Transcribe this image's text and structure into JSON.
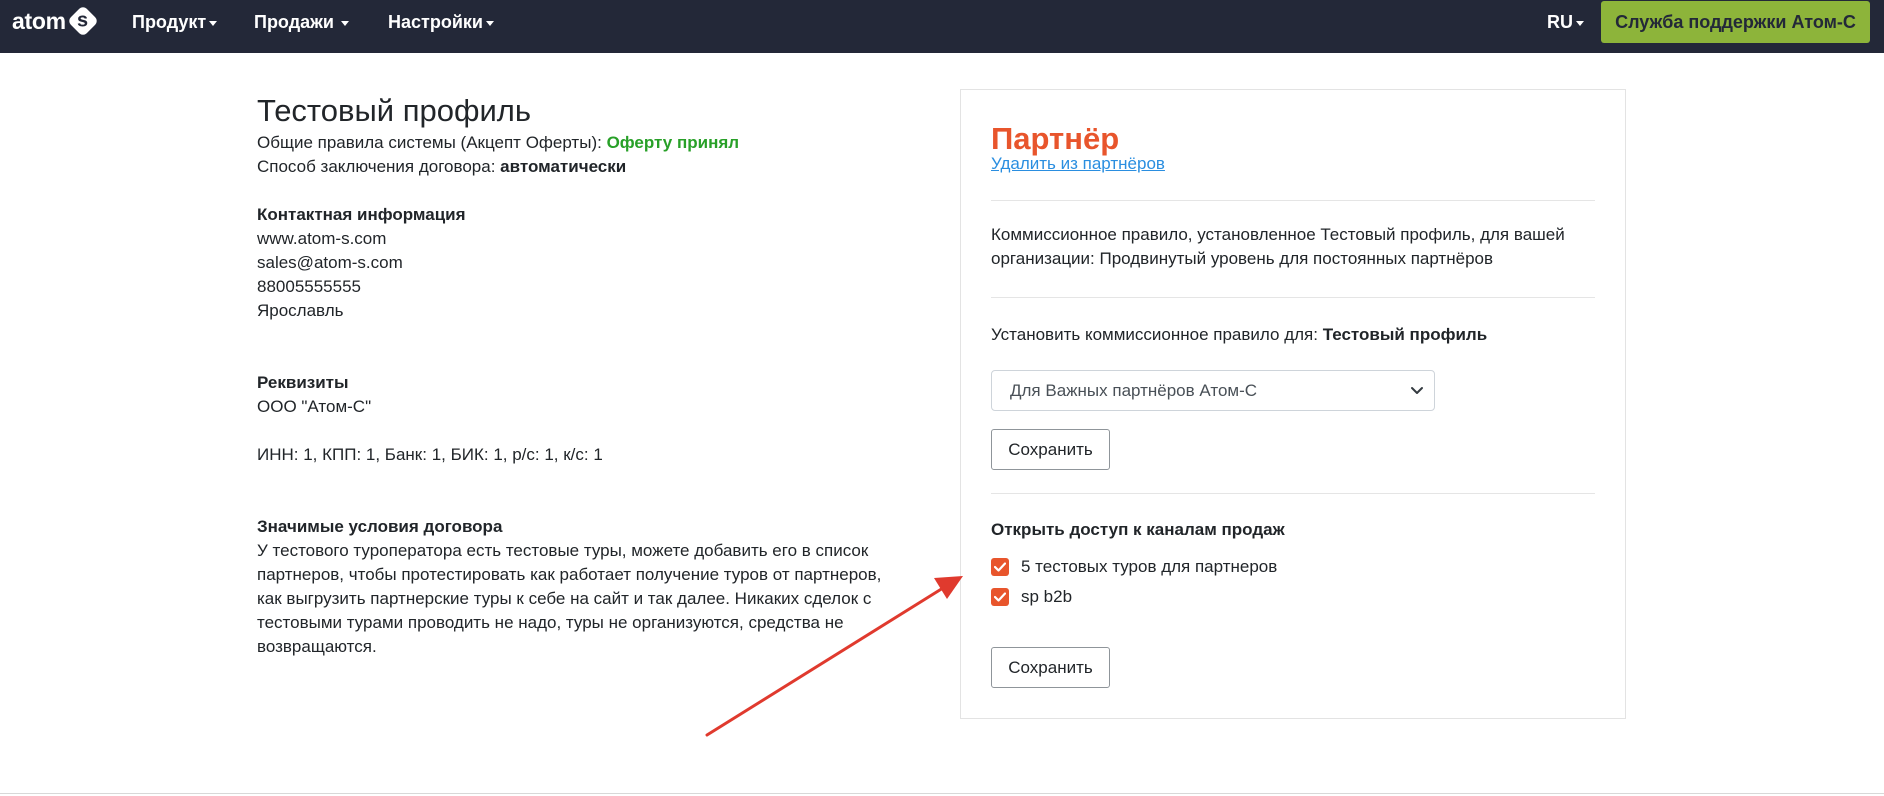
{
  "nav": {
    "logo_text": "atom",
    "logo_badge": "s",
    "items": [
      {
        "label": "Продукт"
      },
      {
        "label": "Продажи"
      },
      {
        "label": "Настройки"
      }
    ],
    "lang": "RU",
    "support_label": "Служба поддержки Атом-С"
  },
  "profile": {
    "title": "Тестовый профиль",
    "rules_label": "Общие правила системы (Акцепт Оферты):",
    "rules_value": "Оферту принял",
    "contract_label": "Способ заключения договора:",
    "contract_value": "автоматически",
    "contacts_title": "Контактная информация",
    "contacts": [
      "www.atom-s.com",
      "sales@atom-s.com",
      "88005555555",
      "Ярославль"
    ],
    "requisites_title": "Реквизиты",
    "company": "ООО \"Атом-С\"",
    "requisites": "ИНН: 1, КПП: 1, Банк: 1, БИК: 1, р/с: 1, к/с: 1",
    "terms_title": "Значимые условия договора",
    "terms_lines": [
      "У тестового туроператора есть тестовые туры, можете добавить его в список",
      "партнеров, чтобы протестировать как работает получение туров от партнеров,",
      "как выгрузить партнерские туры к себе на сайт и так далее. Никаких сделок с",
      "тестовыми турами проводить не надо, туры не организуются, средства не",
      "возвращаются."
    ]
  },
  "partner": {
    "title": "Партнёр",
    "remove_link": "Удалить из партнёров",
    "commission_lines": [
      "Коммиссионное правило, установленное Тестовый профиль, для вашей",
      "организации: Продвинутый уровень для постоянных партнёров"
    ],
    "set_rule_label": "Установить коммиссионное правило для:",
    "set_rule_target": "Тестовый профиль",
    "select_value": "Для Важных партнёров Атом-С",
    "save_label": "Сохранить",
    "channels_title": "Открыть доступ к каналам продаж",
    "channels": [
      {
        "label": "5 тестовых туров для партнеров",
        "checked": true
      },
      {
        "label": "sp b2b",
        "checked": true
      }
    ],
    "save2_label": "Сохранить"
  },
  "colors": {
    "navbar": "#232838",
    "support_button": "#8db43a",
    "accent": "#e8552c",
    "link": "#2a8ee0",
    "success": "#28a028",
    "annotation_arrow": "#e03a2e"
  }
}
